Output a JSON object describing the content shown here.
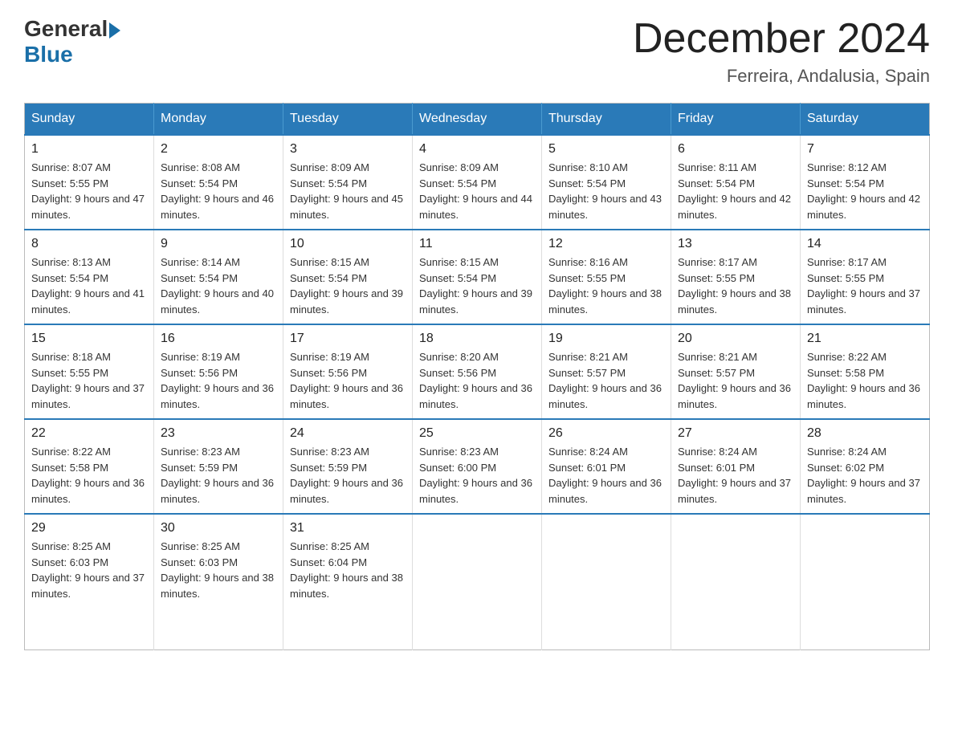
{
  "header": {
    "logo_general": "General",
    "logo_blue": "Blue",
    "month_title": "December 2024",
    "location": "Ferreira, Andalusia, Spain"
  },
  "days_of_week": [
    "Sunday",
    "Monday",
    "Tuesday",
    "Wednesday",
    "Thursday",
    "Friday",
    "Saturday"
  ],
  "weeks": [
    [
      {
        "day": "1",
        "sunrise": "8:07 AM",
        "sunset": "5:55 PM",
        "daylight": "9 hours and 47 minutes."
      },
      {
        "day": "2",
        "sunrise": "8:08 AM",
        "sunset": "5:54 PM",
        "daylight": "9 hours and 46 minutes."
      },
      {
        "day": "3",
        "sunrise": "8:09 AM",
        "sunset": "5:54 PM",
        "daylight": "9 hours and 45 minutes."
      },
      {
        "day": "4",
        "sunrise": "8:09 AM",
        "sunset": "5:54 PM",
        "daylight": "9 hours and 44 minutes."
      },
      {
        "day": "5",
        "sunrise": "8:10 AM",
        "sunset": "5:54 PM",
        "daylight": "9 hours and 43 minutes."
      },
      {
        "day": "6",
        "sunrise": "8:11 AM",
        "sunset": "5:54 PM",
        "daylight": "9 hours and 42 minutes."
      },
      {
        "day": "7",
        "sunrise": "8:12 AM",
        "sunset": "5:54 PM",
        "daylight": "9 hours and 42 minutes."
      }
    ],
    [
      {
        "day": "8",
        "sunrise": "8:13 AM",
        "sunset": "5:54 PM",
        "daylight": "9 hours and 41 minutes."
      },
      {
        "day": "9",
        "sunrise": "8:14 AM",
        "sunset": "5:54 PM",
        "daylight": "9 hours and 40 minutes."
      },
      {
        "day": "10",
        "sunrise": "8:15 AM",
        "sunset": "5:54 PM",
        "daylight": "9 hours and 39 minutes."
      },
      {
        "day": "11",
        "sunrise": "8:15 AM",
        "sunset": "5:54 PM",
        "daylight": "9 hours and 39 minutes."
      },
      {
        "day": "12",
        "sunrise": "8:16 AM",
        "sunset": "5:55 PM",
        "daylight": "9 hours and 38 minutes."
      },
      {
        "day": "13",
        "sunrise": "8:17 AM",
        "sunset": "5:55 PM",
        "daylight": "9 hours and 38 minutes."
      },
      {
        "day": "14",
        "sunrise": "8:17 AM",
        "sunset": "5:55 PM",
        "daylight": "9 hours and 37 minutes."
      }
    ],
    [
      {
        "day": "15",
        "sunrise": "8:18 AM",
        "sunset": "5:55 PM",
        "daylight": "9 hours and 37 minutes."
      },
      {
        "day": "16",
        "sunrise": "8:19 AM",
        "sunset": "5:56 PM",
        "daylight": "9 hours and 36 minutes."
      },
      {
        "day": "17",
        "sunrise": "8:19 AM",
        "sunset": "5:56 PM",
        "daylight": "9 hours and 36 minutes."
      },
      {
        "day": "18",
        "sunrise": "8:20 AM",
        "sunset": "5:56 PM",
        "daylight": "9 hours and 36 minutes."
      },
      {
        "day": "19",
        "sunrise": "8:21 AM",
        "sunset": "5:57 PM",
        "daylight": "9 hours and 36 minutes."
      },
      {
        "day": "20",
        "sunrise": "8:21 AM",
        "sunset": "5:57 PM",
        "daylight": "9 hours and 36 minutes."
      },
      {
        "day": "21",
        "sunrise": "8:22 AM",
        "sunset": "5:58 PM",
        "daylight": "9 hours and 36 minutes."
      }
    ],
    [
      {
        "day": "22",
        "sunrise": "8:22 AM",
        "sunset": "5:58 PM",
        "daylight": "9 hours and 36 minutes."
      },
      {
        "day": "23",
        "sunrise": "8:23 AM",
        "sunset": "5:59 PM",
        "daylight": "9 hours and 36 minutes."
      },
      {
        "day": "24",
        "sunrise": "8:23 AM",
        "sunset": "5:59 PM",
        "daylight": "9 hours and 36 minutes."
      },
      {
        "day": "25",
        "sunrise": "8:23 AM",
        "sunset": "6:00 PM",
        "daylight": "9 hours and 36 minutes."
      },
      {
        "day": "26",
        "sunrise": "8:24 AM",
        "sunset": "6:01 PM",
        "daylight": "9 hours and 36 minutes."
      },
      {
        "day": "27",
        "sunrise": "8:24 AM",
        "sunset": "6:01 PM",
        "daylight": "9 hours and 37 minutes."
      },
      {
        "day": "28",
        "sunrise": "8:24 AM",
        "sunset": "6:02 PM",
        "daylight": "9 hours and 37 minutes."
      }
    ],
    [
      {
        "day": "29",
        "sunrise": "8:25 AM",
        "sunset": "6:03 PM",
        "daylight": "9 hours and 37 minutes."
      },
      {
        "day": "30",
        "sunrise": "8:25 AM",
        "sunset": "6:03 PM",
        "daylight": "9 hours and 38 minutes."
      },
      {
        "day": "31",
        "sunrise": "8:25 AM",
        "sunset": "6:04 PM",
        "daylight": "9 hours and 38 minutes."
      },
      null,
      null,
      null,
      null
    ]
  ]
}
